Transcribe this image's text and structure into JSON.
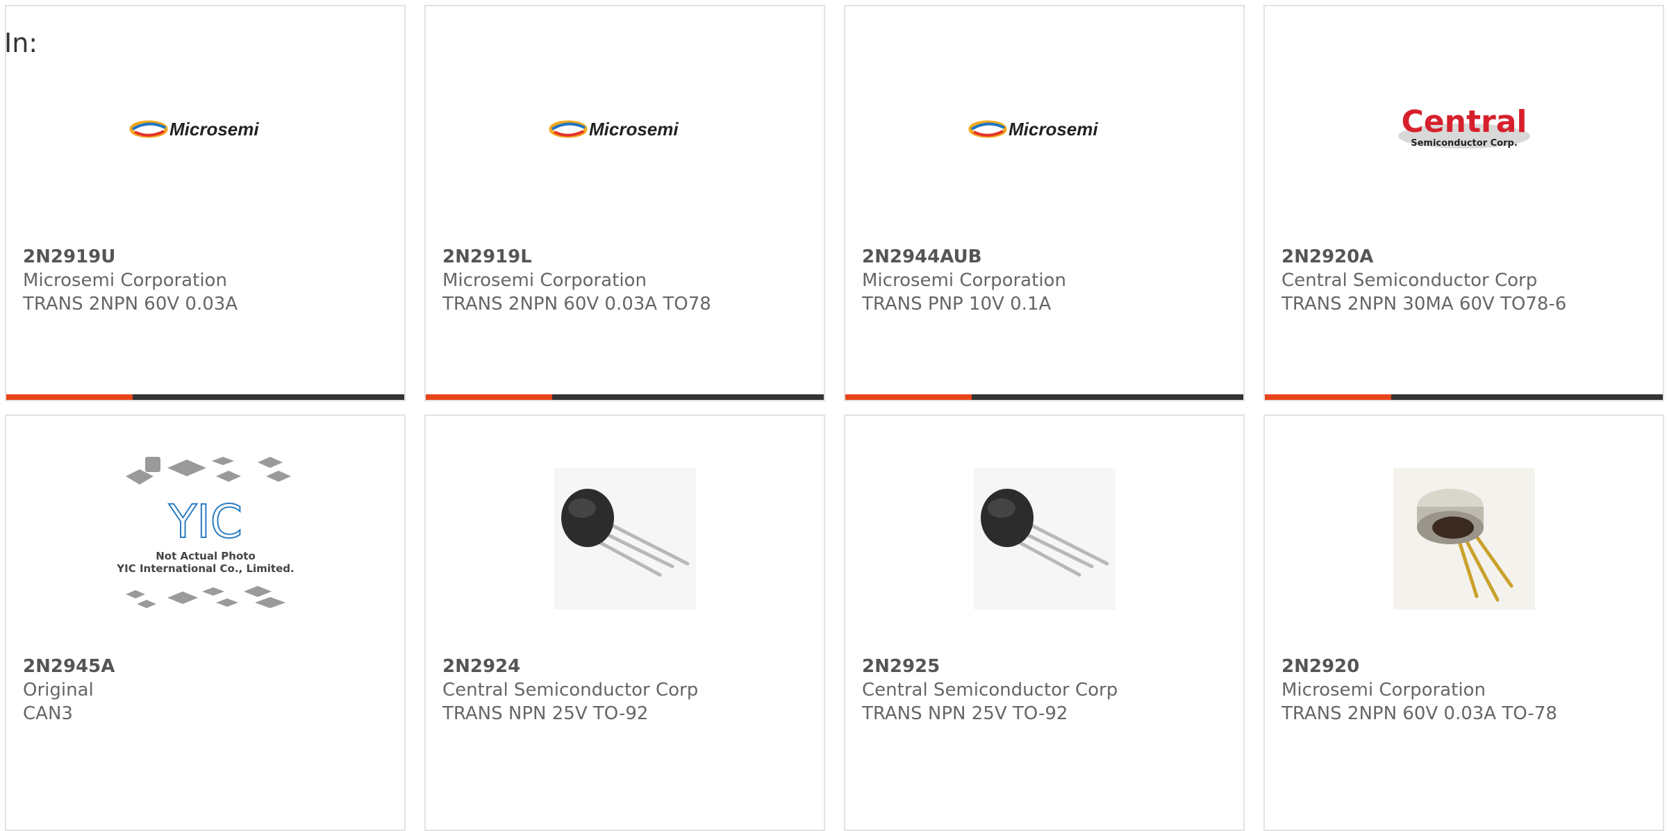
{
  "filter_label": "In:",
  "products": [
    {
      "part": "2N2919U",
      "maker": "Microsemi Corporation",
      "desc": "TRANS 2NPN 60V 0.03A",
      "image": "microsemi-logo"
    },
    {
      "part": "2N2919L",
      "maker": "Microsemi Corporation",
      "desc": "TRANS 2NPN 60V 0.03A TO78",
      "image": "microsemi-logo"
    },
    {
      "part": "2N2944AUB",
      "maker": "Microsemi Corporation",
      "desc": "TRANS PNP 10V 0.1A",
      "image": "microsemi-logo"
    },
    {
      "part": "2N2920A",
      "maker": "Central Semiconductor Corp",
      "desc": "TRANS 2NPN 30MA 60V TO78-6",
      "image": "central-semiconductor-logo"
    },
    {
      "part": "2N2945A",
      "maker": "Original",
      "desc": "CAN3",
      "image": "not-actual-photo-placeholder"
    },
    {
      "part": "2N2924",
      "maker": "Central Semiconductor Corp",
      "desc": "TRANS NPN 25V TO-92",
      "image": "to92-transistor-photo"
    },
    {
      "part": "2N2925",
      "maker": "Central Semiconductor Corp",
      "desc": "TRANS NPN 25V TO-92",
      "image": "to92-transistor-photo"
    },
    {
      "part": "2N2920",
      "maker": "Microsemi Corporation",
      "desc": "TRANS 2NPN 60V 0.03A TO-78",
      "image": "to78-metal-can-photo"
    }
  ],
  "logos": {
    "microsemi_text": "Microsemi",
    "central_text": "Central",
    "central_sub": "Semiconductor Corp.",
    "placeholder_brand": "YIC",
    "placeholder_line1": "Not Actual Photo",
    "placeholder_line2": "YIC International Co., Limited."
  },
  "colors": {
    "accent": "#e8441c",
    "bar": "#333333",
    "border": "#e2e2e2"
  }
}
